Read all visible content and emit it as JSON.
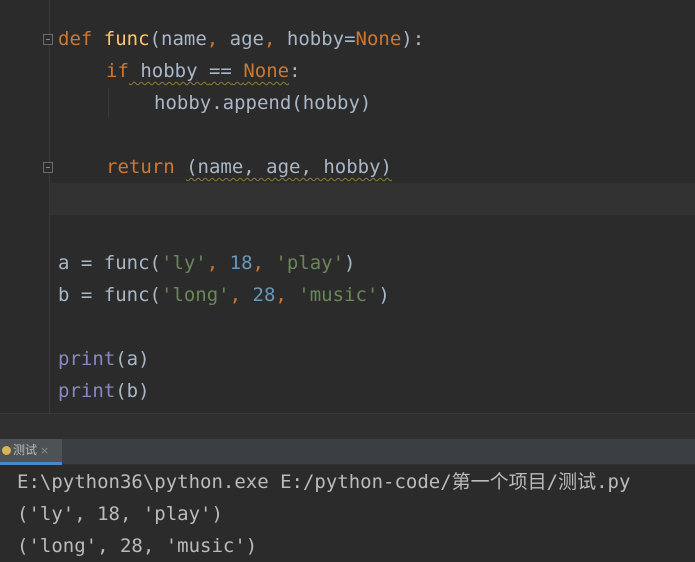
{
  "editor": {
    "lines": [
      {
        "def": "def",
        "fname": "func",
        "open": "(",
        "p1": "name",
        "c1": ", ",
        "p2": "age",
        "c2": ", ",
        "p3": "hobby",
        "eq": "=",
        "none": "None",
        "close": "):"
      },
      {
        "if": "if",
        "cond_a": " hobby ",
        "op": "==",
        "sp": " ",
        "none": "None",
        "colon": ":"
      },
      {
        "text": "hobby.append(hobby)"
      },
      {
        "ret": "return",
        "sp": " ",
        "tuple": "(name, age, hobby)"
      },
      {
        "var": "a",
        "eq": " = func(",
        "s1": "'ly'",
        "c": ", ",
        "n": "18",
        "c2": ", ",
        "s2": "'play'",
        "close": ")"
      },
      {
        "var": "b",
        "eq": " = func(",
        "s1": "'long'",
        "c": ", ",
        "n": "28",
        "c2": ", ",
        "s2": "'music'",
        "close": ")"
      },
      {
        "fn": "print",
        "arg": "(a)"
      },
      {
        "fn": "print",
        "arg": "(b)"
      }
    ]
  },
  "run_panel": {
    "tab_label": "测试",
    "close_glyph": "×"
  },
  "console": {
    "lines": [
      "E:\\python36\\python.exe E:/python-code/第一个项目/测试.py",
      "('ly', 18, 'play')",
      "('long', 28, 'music')"
    ]
  },
  "colors": {
    "background": "#2b2b2b",
    "keyword": "#cc7832",
    "function": "#ffc66d",
    "string": "#6a8759",
    "number": "#6897bb",
    "builtin": "#8888c6",
    "text": "#a9b7c6",
    "tab_accent": "#4a88c7"
  }
}
